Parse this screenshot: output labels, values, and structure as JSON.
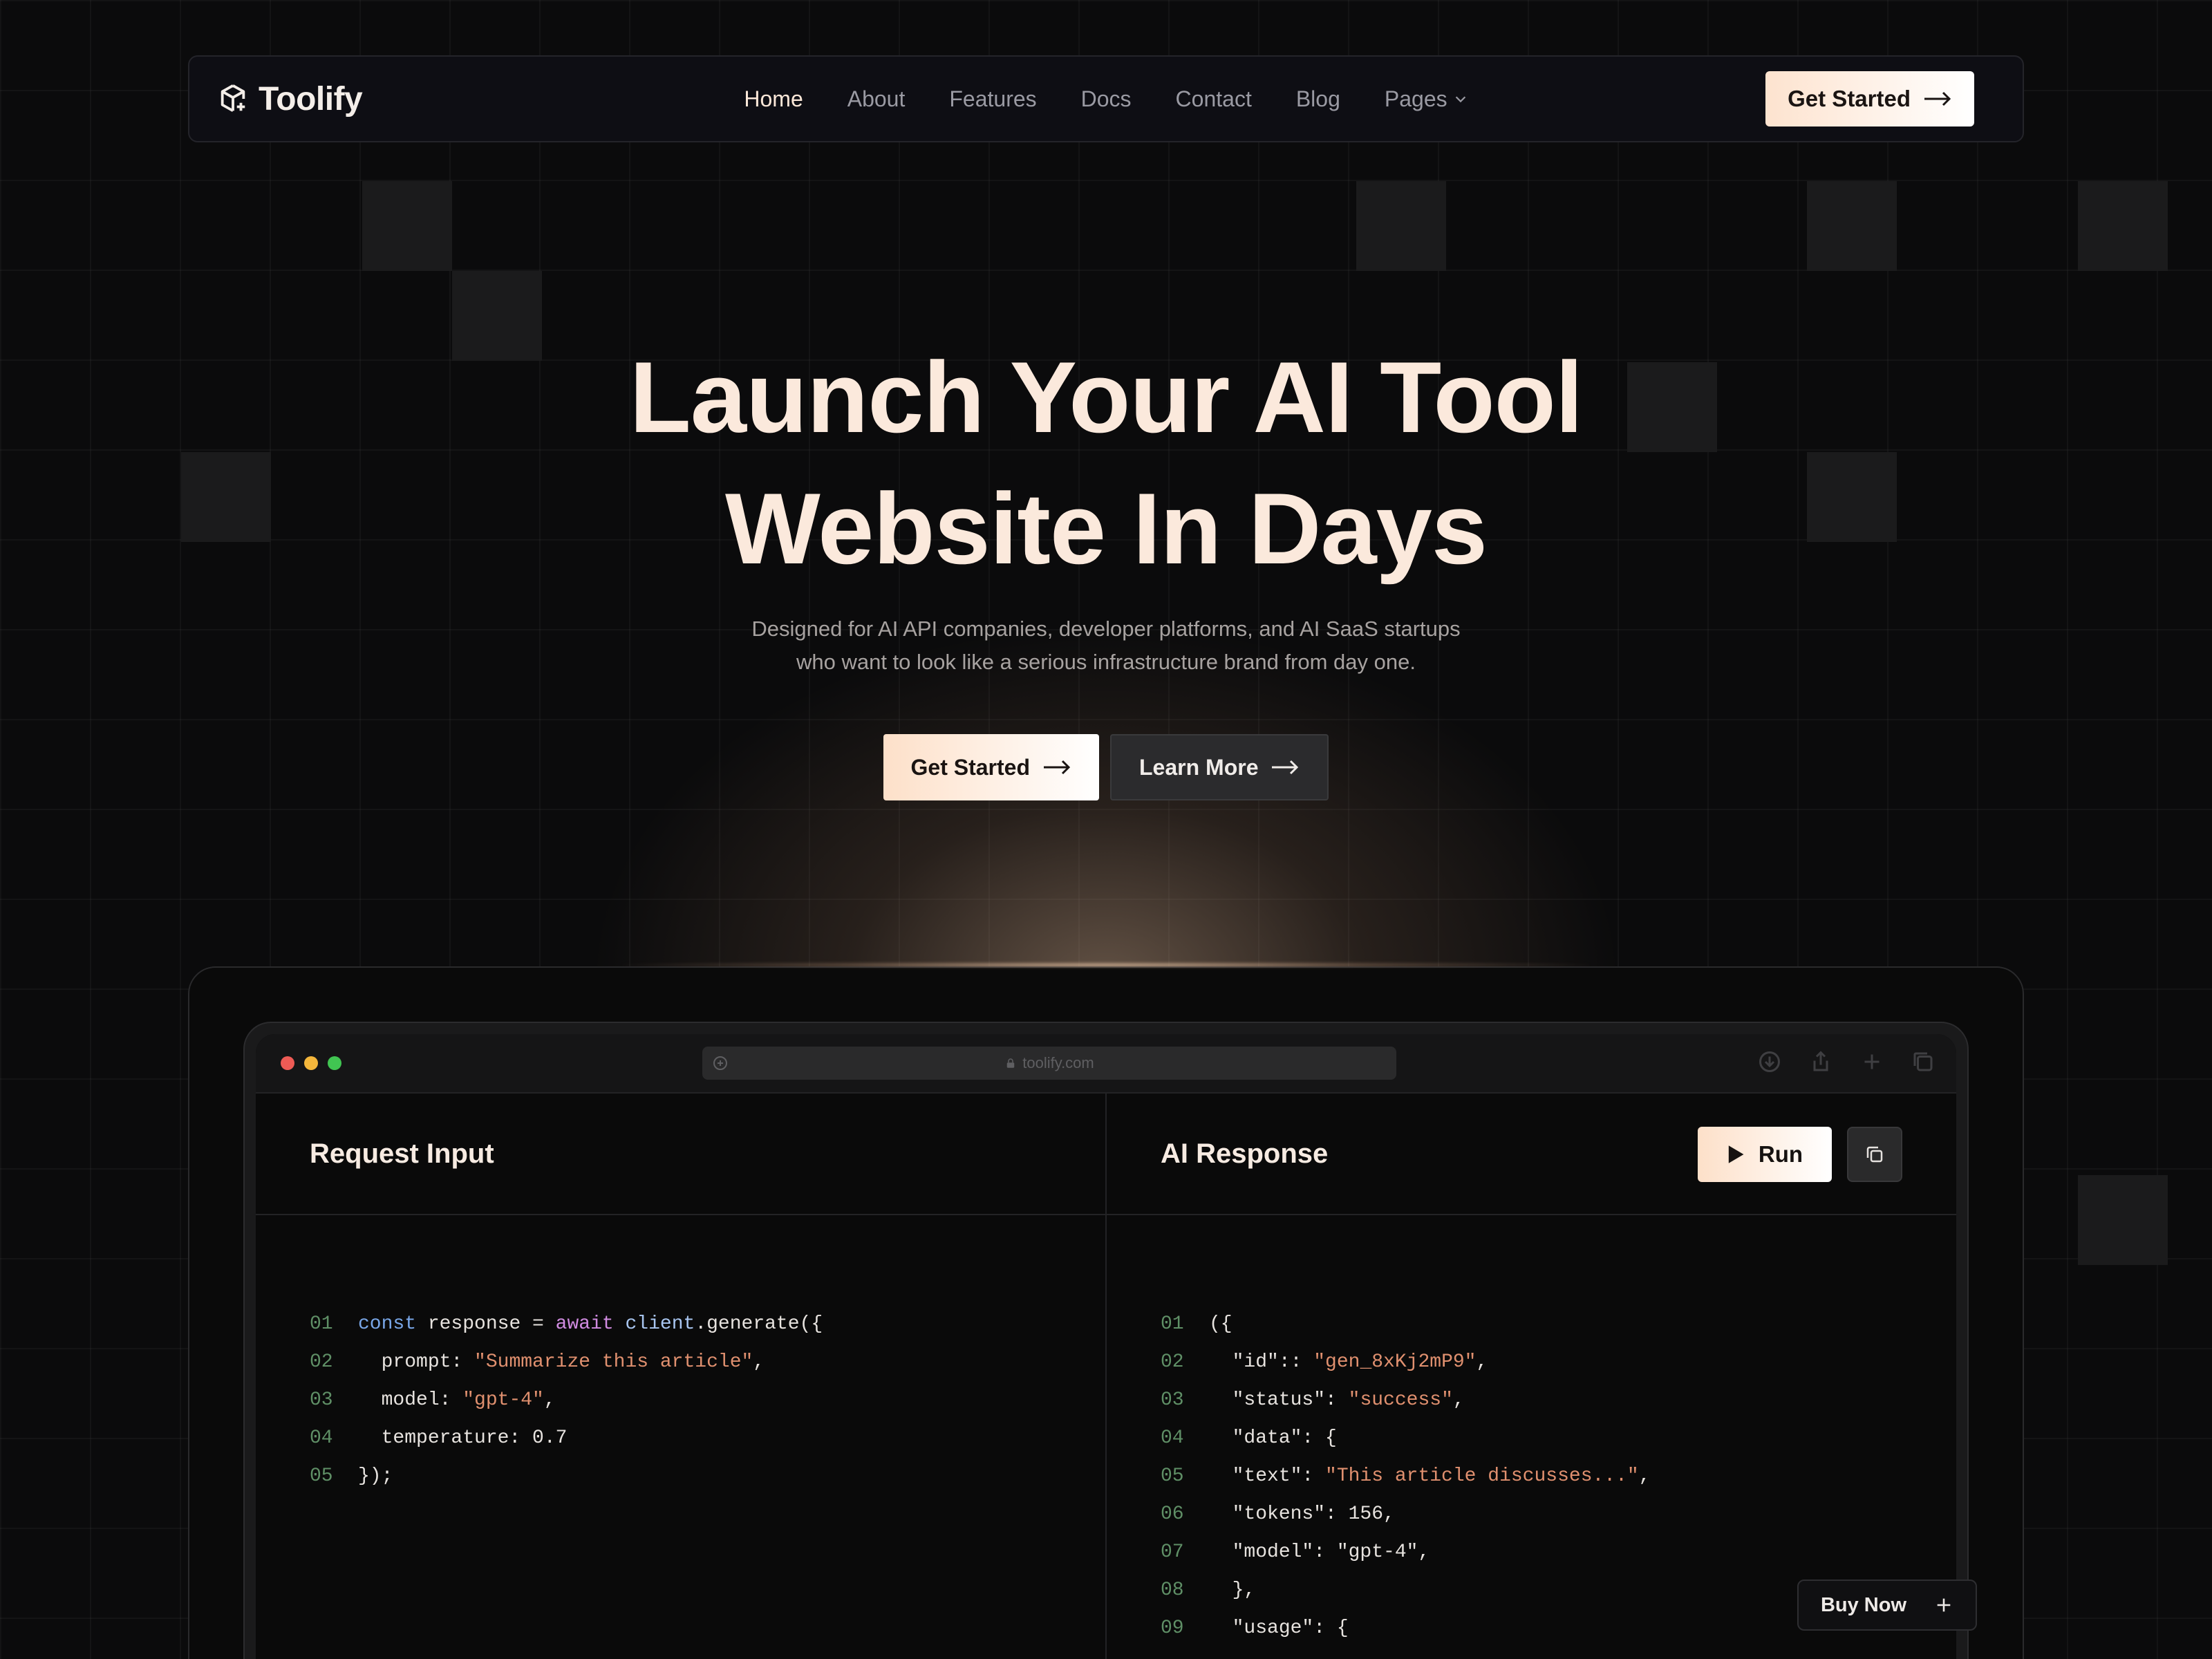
{
  "brand": {
    "name": "Toolify",
    "icon": "cube-sparkle-icon"
  },
  "nav": {
    "links": [
      {
        "label": "Home",
        "active": true
      },
      {
        "label": "About"
      },
      {
        "label": "Features"
      },
      {
        "label": "Docs"
      },
      {
        "label": "Contact"
      },
      {
        "label": "Blog"
      },
      {
        "label": "Pages",
        "dropdown": true
      }
    ],
    "cta_label": "Get Started"
  },
  "hero": {
    "title_line1": "Launch Your AI Tool",
    "title_line2": "Website In Days",
    "subtitle_line1": "Designed for AI API companies, developer platforms, and AI SaaS startups",
    "subtitle_line2": "who want to look like a serious infrastructure brand from day one.",
    "primary_label": "Get Started",
    "secondary_label": "Learn More"
  },
  "browser": {
    "url": "toolify.com",
    "dot_colors": [
      "#ee5b55",
      "#f4b63b",
      "#41c552"
    ]
  },
  "request_panel": {
    "title": "Request Input",
    "lines": [
      {
        "n": "01",
        "parts": [
          [
            "key",
            "const"
          ],
          [
            "txt",
            " response = "
          ],
          [
            "await",
            "await"
          ],
          [
            "txt",
            " "
          ],
          [
            "fn",
            "client"
          ],
          [
            "txt",
            ".generate({"
          ]
        ]
      },
      {
        "n": "02",
        "parts": [
          [
            "txt",
            "  prompt: "
          ],
          [
            "str",
            "\"Summarize this article\""
          ],
          [
            "txt",
            ","
          ]
        ]
      },
      {
        "n": "03",
        "parts": [
          [
            "txt",
            "  model: "
          ],
          [
            "str",
            "\"gpt-4\""
          ],
          [
            "txt",
            ","
          ]
        ]
      },
      {
        "n": "04",
        "parts": [
          [
            "txt",
            "  temperature: 0.7"
          ]
        ]
      },
      {
        "n": "05",
        "parts": [
          [
            "txt",
            "});"
          ]
        ]
      }
    ]
  },
  "response_panel": {
    "title": "AI Response",
    "run_label": "Run",
    "lines": [
      {
        "n": "01",
        "parts": [
          [
            "txt",
            "({"
          ]
        ]
      },
      {
        "n": "02",
        "parts": [
          [
            "txt",
            "  \"id\":: "
          ],
          [
            "str",
            "\"gen_8xKj2mP9\""
          ],
          [
            "txt",
            ","
          ]
        ]
      },
      {
        "n": "03",
        "parts": [
          [
            "txt",
            "  \"status\": "
          ],
          [
            "str",
            "\"success\""
          ],
          [
            "txt",
            ","
          ]
        ]
      },
      {
        "n": "04",
        "parts": [
          [
            "txt",
            "  \"data\": {"
          ]
        ]
      },
      {
        "n": "05",
        "parts": [
          [
            "txt",
            "  \"text\": "
          ],
          [
            "str",
            "\"This article discusses...\""
          ],
          [
            "txt",
            ","
          ]
        ]
      },
      {
        "n": "06",
        "parts": [
          [
            "txt",
            "  \"tokens\": 156,"
          ]
        ]
      },
      {
        "n": "07",
        "parts": [
          [
            "txt",
            "  \"model\": \"gpt-4\","
          ]
        ]
      },
      {
        "n": "08",
        "parts": [
          [
            "txt",
            "  },"
          ]
        ]
      },
      {
        "n": "09",
        "parts": [
          [
            "txt",
            "  \"usage\": {"
          ]
        ]
      }
    ]
  },
  "buy_now_label": "Buy Now",
  "colors": {
    "accent_peach": "#fde0c9",
    "background": "#0b0b0c",
    "line_number": "#5f8f66",
    "string": "#e0906f"
  }
}
